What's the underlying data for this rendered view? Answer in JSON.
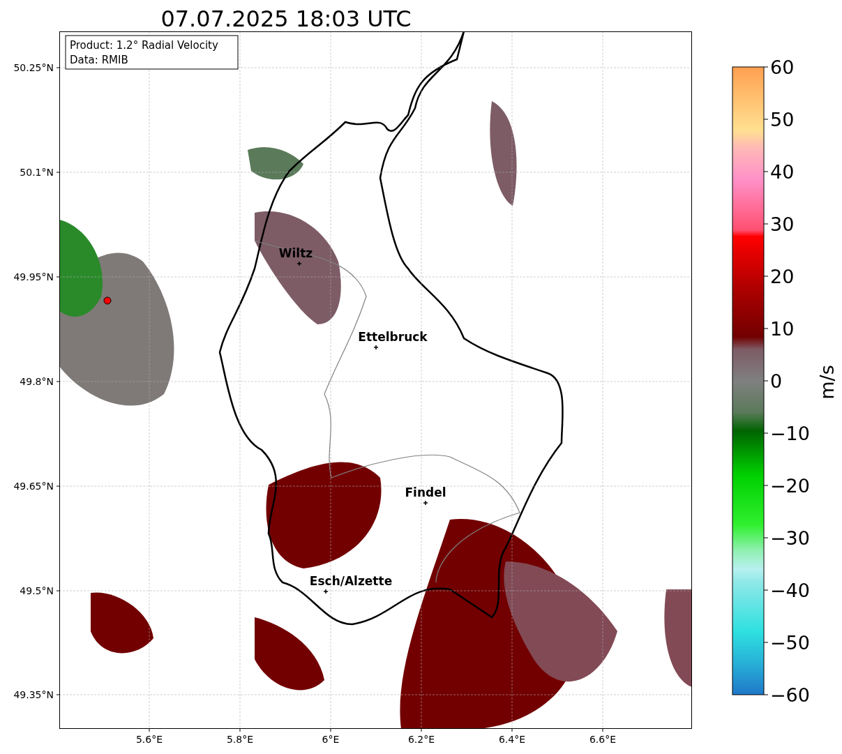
{
  "title": "07.07.2025 18:03 UTC",
  "info_box": {
    "lines": [
      "Product: 1.2° Radial Velocity",
      "Data: RMIB"
    ]
  },
  "map": {
    "places": [
      {
        "name": "Wiltz"
      },
      {
        "name": "Ettelbruck"
      },
      {
        "name": "Findel"
      },
      {
        "name": "Esch/Alzette"
      }
    ]
  },
  "y_ticks": [
    "50.25°N",
    "50.1°N",
    "49.95°N",
    "49.8°N",
    "49.65°N",
    "49.5°N",
    "49.35°N"
  ],
  "x_ticks": [
    "5.6°E",
    "5.8°E",
    "6°E",
    "6.2°E",
    "6.4°E",
    "6.6°E"
  ],
  "colorbar": {
    "label": "m/s",
    "ticks": [
      "60",
      "50",
      "40",
      "30",
      "20",
      "10",
      "0",
      "−10",
      "−20",
      "−30",
      "−40",
      "−50",
      "−60"
    ]
  }
}
